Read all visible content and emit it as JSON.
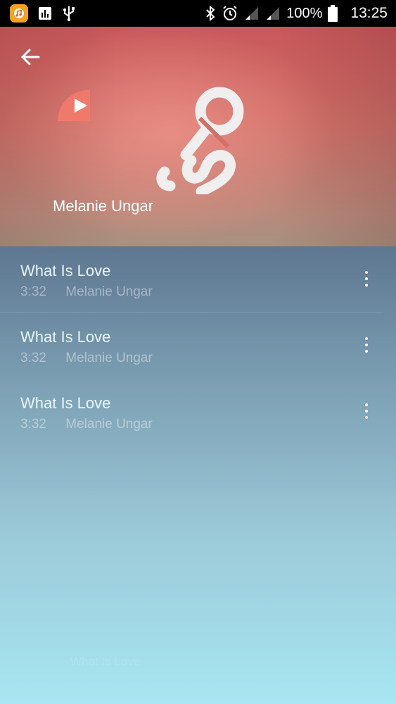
{
  "status_bar": {
    "battery": "100%",
    "time": "13:25",
    "icons": [
      "music-app-icon",
      "equalizer-icon",
      "usb-icon",
      "bluetooth-icon",
      "alarm-icon",
      "signal-icon",
      "signal-icon",
      "battery-icon"
    ]
  },
  "header": {
    "artist_name": "Melanie Ungar",
    "icons": [
      "back-arrow-icon",
      "play-icon",
      "microphone-icon"
    ],
    "colors": {
      "top": "#c9575a",
      "bottom": "#a7917f"
    }
  },
  "songs": [
    {
      "title": "What Is Love",
      "duration": "3:32",
      "artist": "Melanie Ungar"
    },
    {
      "title": "What Is Love",
      "duration": "3:32",
      "artist": "Melanie Ungar"
    },
    {
      "title": "What Is Love",
      "duration": "3:32",
      "artist": "Melanie Ungar"
    }
  ],
  "mini_player": {
    "title": "What Is Love"
  },
  "colors": {
    "list_top": "#5d7790",
    "list_bottom": "#a7e6f2",
    "text": "#e9f6fb"
  }
}
